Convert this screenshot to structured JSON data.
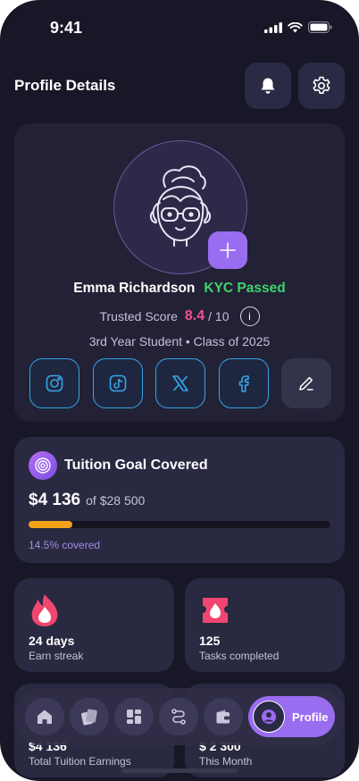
{
  "status_bar": {
    "time": "9:41"
  },
  "header": {
    "title": "Profile Details"
  },
  "profile": {
    "name": "Emma Richardson",
    "kyc_status": "KYC Passed",
    "trusted_score_label": "Trusted Score",
    "trusted_score_value": "8.4",
    "trusted_score_max": "/ 10",
    "info_glyph": "i",
    "student_info": "3rd Year Student • Class of 2025",
    "socials": [
      "instagram-icon",
      "tiktok-icon",
      "x-icon",
      "facebook-icon"
    ]
  },
  "tuition": {
    "title": "Tuition Goal Covered",
    "amount": "$4 136",
    "target": "of $28 500",
    "progress_fraction": 0.145,
    "covered_text": "14.5% covered"
  },
  "stats": [
    {
      "value": "24 days",
      "label": "Earn streak",
      "icon": "flame-icon"
    },
    {
      "value": "125",
      "label": "Tasks completed",
      "icon": "ticket-flame-icon"
    }
  ],
  "partial_stats": [
    {
      "value": "$4 136",
      "label": "Total Tuition Earnings"
    },
    {
      "value": "$ 2 300",
      "label": "This Month"
    }
  ],
  "nav": {
    "items": [
      "home-icon",
      "cards-icon",
      "dashboard-icon",
      "route-icon",
      "wallet-icon"
    ],
    "active_label": "Profile"
  },
  "colors": {
    "background": "#171727",
    "card": "#222136",
    "accent": "#9a6cf0",
    "kyc_green": "#3ed36e",
    "score_pink": "#f0528f",
    "progress": "#f3a219"
  }
}
